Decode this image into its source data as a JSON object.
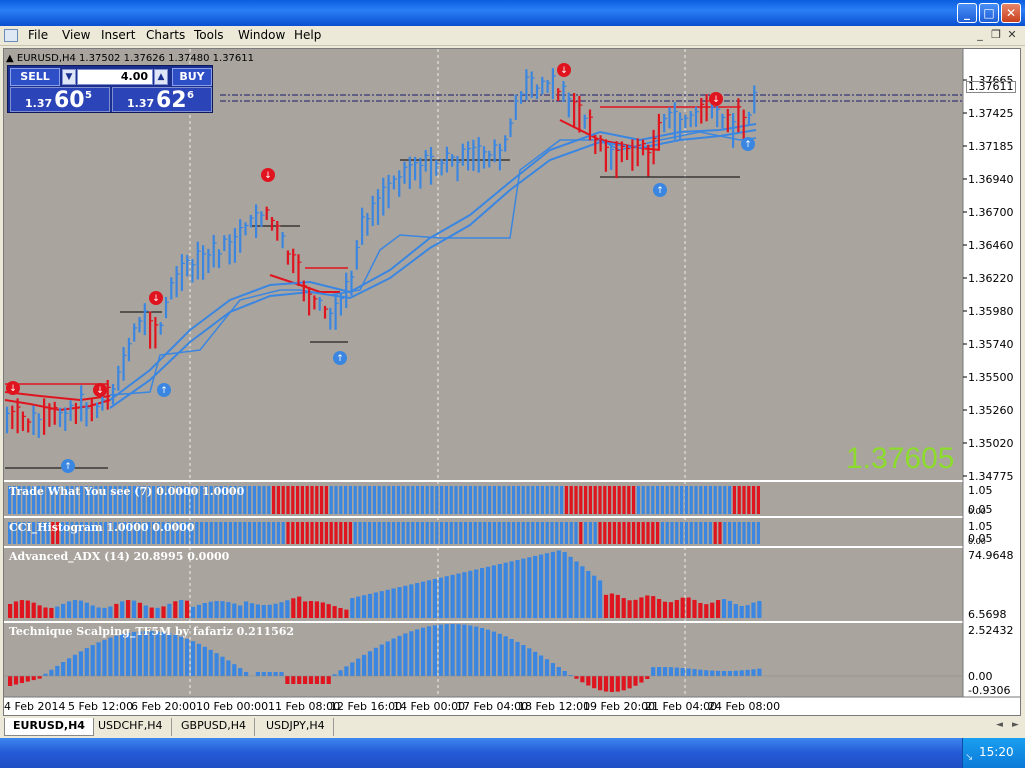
{
  "window": {
    "title": "",
    "minimize": "_",
    "maximize": "□",
    "close": "✕"
  },
  "menu": [
    "File",
    "View",
    "Insert",
    "Charts",
    "Tools",
    "Window",
    "Help"
  ],
  "mdi": {
    "minimize": "_",
    "restore": "❐",
    "close": "✕"
  },
  "chart": {
    "header": "▲ EURUSD,H4  1.37502 1.37626 1.37480 1.37611",
    "current_price_tag": "1.37611",
    "big_price": "1.37605",
    "price_axis": [
      "1.37665",
      "1.37425",
      "1.37185",
      "1.36940",
      "1.36700",
      "1.36460",
      "1.36220",
      "1.35980",
      "1.35740",
      "1.35500",
      "1.35260",
      "1.35020",
      "1.34775"
    ],
    "dates": [
      "4 Feb 2014",
      "5 Feb 12:00",
      "6 Feb 20:00",
      "10 Feb 00:00",
      "11 Feb 08:00",
      "12 Feb 16:00",
      "14 Feb 00:00",
      "17 Feb 04:00",
      "18 Feb 12:00",
      "19 Feb 20:00",
      "21 Feb 04:00",
      "24 Feb 08:00"
    ]
  },
  "trade_panel": {
    "sell_label": "SELL",
    "buy_label": "BUY",
    "lot_down": "▼",
    "lot_up": "▲",
    "lot_value": "4.00",
    "sell_small": "1.37",
    "sell_big": "60",
    "sell_sup": "5",
    "buy_small": "1.37",
    "buy_big": "62",
    "buy_sup": "6"
  },
  "indicators": [
    {
      "label": "Trade What You see (7) 0.0000 1.0000",
      "axis_top": "1.05",
      "axis_bottom": "0.05",
      "axis_tiny": "0.00"
    },
    {
      "label": "CCI_Histogram 1.0000 0.0000",
      "axis_top": "1.05",
      "axis_bottom": "0.05",
      "axis_tiny": "0.00"
    },
    {
      "label": "Advanced_ADX (14) 20.8995 0.0000",
      "axis_top": "74.9648",
      "axis_bottom": "6.5698"
    },
    {
      "label": "Technique Scalping_TF5M by fafariz 0.211562",
      "axis_top": "2.52432",
      "axis_mid": "0.00",
      "axis_bottom": "-0.9306"
    }
  ],
  "tabs": [
    "EURUSD,H4",
    "USDCHF,H4",
    "GBPUSD,H4",
    "USDJPY,H4"
  ],
  "tab_arrows": [
    "◄",
    "►"
  ],
  "taskbar": {
    "clock": "15:20",
    "resize_grip": "↘"
  },
  "colors": {
    "chart_bg": "#aaa49e",
    "bull": "#3a86e0",
    "bear": "#e0141e",
    "big_price": "#8cdc2c"
  }
}
